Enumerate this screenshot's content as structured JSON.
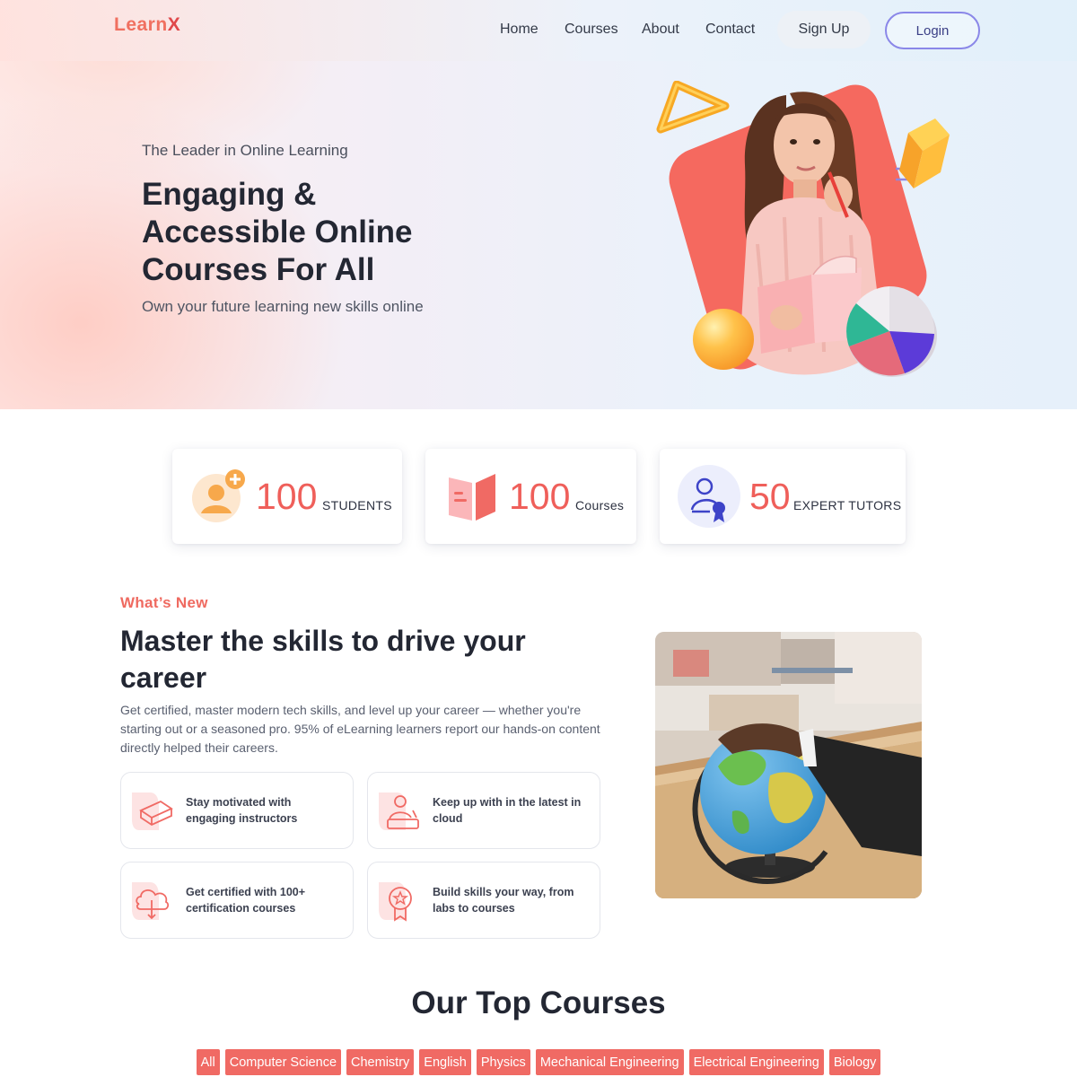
{
  "header": {
    "logo_main": "Learn",
    "logo_accent": "X",
    "nav": [
      {
        "label": "Home"
      },
      {
        "label": "Courses"
      },
      {
        "label": "About"
      },
      {
        "label": "Contact"
      }
    ],
    "signup_label": "Sign Up",
    "login_label": "Login"
  },
  "hero": {
    "eyebrow": "The Leader in Online Learning",
    "title": "Engaging & Accessible Online Courses For All",
    "subtitle": "Own your future learning new skills online"
  },
  "stats": [
    {
      "number": "100",
      "label": "STUDENTS",
      "icon": "student-add-icon"
    },
    {
      "number": "100",
      "label": "Courses",
      "icon": "book-icon"
    },
    {
      "number": "50",
      "label": "EXPERT TUTORS",
      "icon": "tutor-badge-icon"
    }
  ],
  "whats_new": {
    "eyebrow": "What’s New",
    "title": "Master the skills to drive your career",
    "body": "Get certified, master modern tech skills, and level up your career — whether you're starting out or a seasoned pro. 95% of eLearning learners report our hands-on content directly helped their careers.",
    "features": [
      {
        "text": "Stay motivated with engaging instructors",
        "icon": "books-icon"
      },
      {
        "text": "Keep up with in the latest in cloud",
        "icon": "instructor-icon"
      },
      {
        "text": "Get certified with 100+ certification courses",
        "icon": "cloud-download-icon"
      },
      {
        "text": "Build skills your way, from labs to courses",
        "icon": "award-ribbon-icon"
      }
    ]
  },
  "top_courses": {
    "title": "Our Top Courses",
    "filters": [
      "All",
      "Computer Science",
      "Chemistry",
      "English",
      "Physics",
      "Mechanical Engineering",
      "Electrical Engineering",
      "Biology"
    ]
  },
  "colors": {
    "accent": "#f06a64",
    "stat_number": "#ef5f5a",
    "login_border": "#8a87e8",
    "hero_card": "#f5695f"
  }
}
